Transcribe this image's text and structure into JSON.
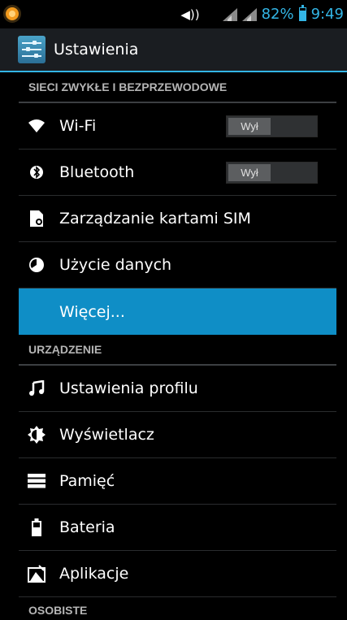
{
  "status_bar": {
    "battery_percent": "82%",
    "battery_level": 0.82,
    "time": "9:49",
    "accent_color": "#33b5e5"
  },
  "action_bar": {
    "title": "Ustawienia",
    "icon": "settings-sliders-icon"
  },
  "sections": {
    "wireless": {
      "header": "SIECI ZWYKŁE I BEZPRZEWODOWE",
      "items": {
        "wifi": {
          "label": "Wi-Fi",
          "icon": "wifi-icon",
          "toggle": "Wył"
        },
        "bluetooth": {
          "label": "Bluetooth",
          "icon": "bluetooth-icon",
          "toggle": "Wył"
        },
        "sim": {
          "label": "Zarządzanie kartami SIM",
          "icon": "sim-card-icon"
        },
        "data_usage": {
          "label": "Użycie danych",
          "icon": "data-usage-icon"
        },
        "more": {
          "label": "Więcej...",
          "selected_color": "#0f8ec6"
        }
      }
    },
    "device": {
      "header": "URZĄDZENIE",
      "items": {
        "profiles": {
          "label": "Ustawienia profilu",
          "icon": "music-note-icon"
        },
        "display": {
          "label": "Wyświetlacz",
          "icon": "brightness-icon"
        },
        "storage": {
          "label": "Pamięć",
          "icon": "storage-icon"
        },
        "battery": {
          "label": "Bateria",
          "icon": "battery-icon"
        },
        "apps": {
          "label": "Aplikacje",
          "icon": "apps-icon"
        }
      }
    },
    "personal": {
      "header": "OSOBISTE"
    }
  }
}
